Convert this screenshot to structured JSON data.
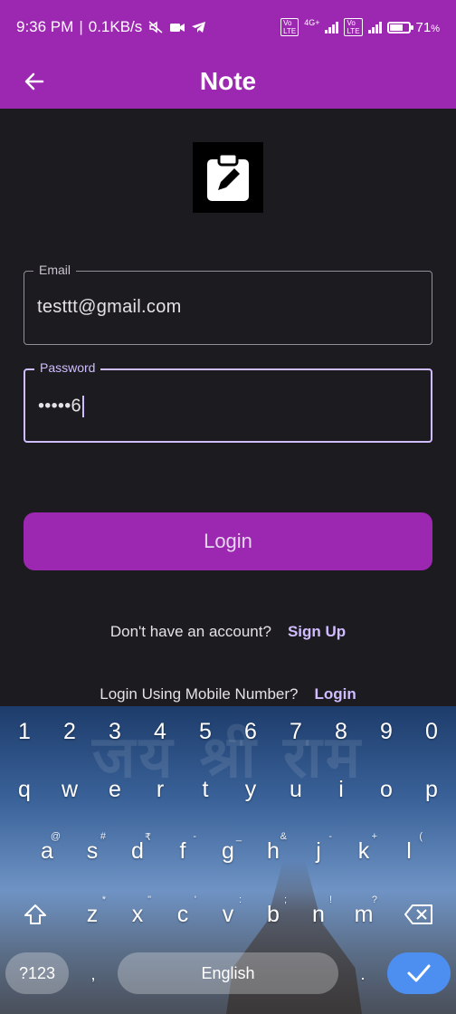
{
  "status_bar": {
    "time": "9:36 PM",
    "speed": "0.1KB/s",
    "network": "4G+",
    "volte_label": "Vo LTE",
    "battery_percent": "71",
    "battery_level": 0.71
  },
  "app_bar": {
    "title": "Note",
    "back_icon": "arrow-back-icon"
  },
  "logo": {
    "icon": "clipboard-edit-icon"
  },
  "form": {
    "email": {
      "label": "Email",
      "value": "testtt@gmail.com"
    },
    "password": {
      "label": "Password",
      "value": "•••••6"
    },
    "login_button": "Login"
  },
  "links": {
    "signup_prompt": "Don't have an account?",
    "signup_link": "Sign Up",
    "mobile_prompt": "Login Using Mobile Number?",
    "mobile_link": "Login"
  },
  "keyboard": {
    "background_art": "जय श्री राम",
    "digits": [
      "1",
      "2",
      "3",
      "4",
      "5",
      "6",
      "7",
      "8",
      "9",
      "0"
    ],
    "row1": [
      "q",
      "w",
      "e",
      "r",
      "t",
      "y",
      "u",
      "i",
      "o",
      "p"
    ],
    "row2": [
      {
        "k": "a",
        "h": "@"
      },
      {
        "k": "s",
        "h": "#"
      },
      {
        "k": "d",
        "h": "₹"
      },
      {
        "k": "f",
        "h": "-"
      },
      {
        "k": "g",
        "h": "_"
      },
      {
        "k": "h",
        "h": "&"
      },
      {
        "k": "j",
        "h": "-"
      },
      {
        "k": "k",
        "h": "+"
      },
      {
        "k": "l",
        "h": "("
      },
      {
        "k": "",
        "h": ")"
      }
    ],
    "row3": [
      {
        "k": "z",
        "h": "*"
      },
      {
        "k": "x",
        "h": "\""
      },
      {
        "k": "c",
        "h": "'"
      },
      {
        "k": "v",
        "h": ":"
      },
      {
        "k": "b",
        "h": ";"
      },
      {
        "k": "n",
        "h": "!"
      },
      {
        "k": "m",
        "h": "?"
      }
    ],
    "symbols_key": "?123",
    "comma_key": ",",
    "space_label": "English",
    "period_key": ".",
    "shift_icon": "shift-icon",
    "backspace_icon": "backspace-icon",
    "done_icon": "checkmark-icon"
  }
}
